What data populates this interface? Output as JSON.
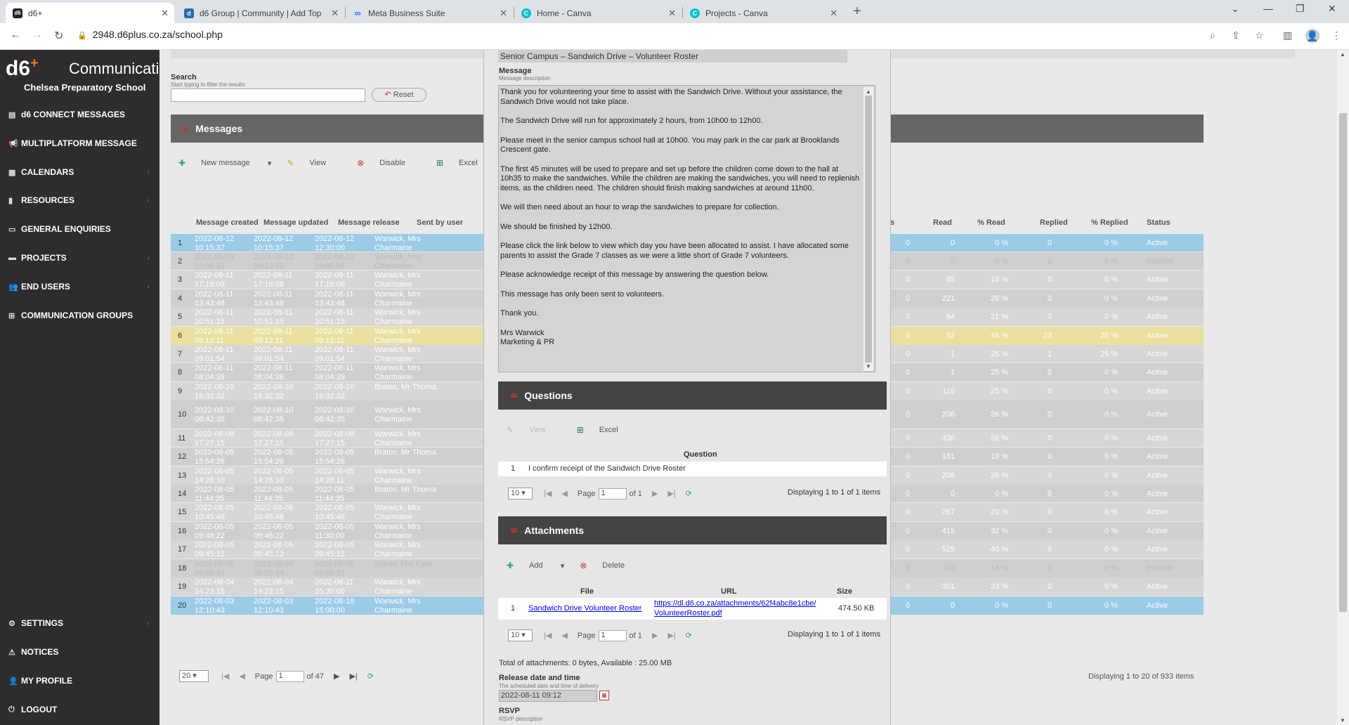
{
  "browser": {
    "tabs": [
      {
        "label": "d6+",
        "icon": "d6-favicon",
        "active": true
      },
      {
        "label": "d6 Group | Community | Add Top",
        "icon": "d6-group-favicon"
      },
      {
        "label": "Meta Business Suite",
        "icon": "meta-favicon"
      },
      {
        "label": "Home - Canva",
        "icon": "canva-favicon"
      },
      {
        "label": "Projects - Canva",
        "icon": "canva-favicon"
      }
    ],
    "url": "2948.d6plus.co.za/school.php"
  },
  "sidebar": {
    "logo": "d6",
    "logo_plus": "+",
    "logo_word": "Communication",
    "school": "Chelsea Preparatory School",
    "items": [
      {
        "label": "d6 CONNECT MESSAGES",
        "icon": "inbox-icon"
      },
      {
        "label": "MULTIPLATFORM MESSAGE",
        "icon": "megaphone-icon"
      },
      {
        "label": "CALENDARS",
        "icon": "calendar-icon"
      },
      {
        "label": "RESOURCES",
        "icon": "book-icon"
      },
      {
        "label": "GENERAL ENQUIRIES",
        "icon": "tray-icon"
      },
      {
        "label": "PROJECTS",
        "icon": "folder-icon"
      },
      {
        "label": "END USERS",
        "icon": "users-icon"
      },
      {
        "label": "COMMUNICATION GROUPS",
        "icon": "sitemap-icon"
      }
    ],
    "bottom_items": [
      {
        "label": "SETTINGS",
        "icon": "gear-icon"
      },
      {
        "label": "NOTICES",
        "icon": "warning-icon"
      },
      {
        "label": "MY PROFILE",
        "icon": "user-icon"
      },
      {
        "label": "LOGOUT",
        "icon": "power-icon"
      }
    ]
  },
  "search": {
    "label": "Search",
    "hint": "Start typing to filter the results",
    "reset_label": "Reset"
  },
  "messages_panel": {
    "title": "Messages",
    "toolbar": {
      "new_message": "New message",
      "view": "View",
      "disable": "Disable",
      "excel": "Excel"
    },
    "columns": [
      "Message created",
      "Message updated",
      "Message release",
      "Sent by user",
      "s",
      "Read",
      "% Read",
      "Replied",
      "% Replied",
      "Status"
    ],
    "rows": [
      {
        "n": "1",
        "created": [
          "2022-08-12",
          "10:15:37"
        ],
        "updated": [
          "2022-08-12",
          "10:15:37"
        ],
        "release": [
          "2022-08-12",
          "12:30:00"
        ],
        "user": [
          "Warwick, Mrs",
          "Charmaine"
        ],
        "s": "0",
        "read": "0",
        "pread": "0 %",
        "replied": "0",
        "preplied": "0 %",
        "status": "Active",
        "style": "sel"
      },
      {
        "n": "2",
        "created": [
          "2022-00-03",
          "12:04:33"
        ],
        "updated": [
          "2022-08-12",
          "10:12:42"
        ],
        "release": [
          "2022-08-12",
          "15:00:00"
        ],
        "user": [
          "Warwick, Mrs",
          "Charmaine"
        ],
        "s": "0",
        "read": "0",
        "pread": "0 %",
        "replied": "0",
        "preplied": "0 %",
        "status": "Inactive",
        "style": "inactive"
      },
      {
        "n": "3",
        "created": [
          "2022-08-11",
          "17:16:08"
        ],
        "updated": [
          "2022-08-11",
          "17:16:08"
        ],
        "release": [
          "2022-08-11",
          "17:16:08"
        ],
        "user": [
          "Warwick, Mrs",
          "Charmaine"
        ],
        "s": "0",
        "read": "85",
        "pread": "18 %",
        "replied": "0",
        "preplied": "0 %",
        "status": "Active",
        "style": ""
      },
      {
        "n": "4",
        "created": [
          "2022-08-11",
          "13:43:48"
        ],
        "updated": [
          "2022-08-11",
          "13:43:48"
        ],
        "release": [
          "2022-08-11",
          "13:43:48"
        ],
        "user": [
          "Warwick, Mrs",
          "Charmaine"
        ],
        "s": "0",
        "read": "221",
        "pread": "28 %",
        "replied": "0",
        "preplied": "0 %",
        "status": "Active",
        "style": ""
      },
      {
        "n": "5",
        "created": [
          "2022-08-11",
          "10:51:15"
        ],
        "updated": [
          "2022-08-11",
          "10:51:15"
        ],
        "release": [
          "2022-08-11",
          "10:51:15"
        ],
        "user": [
          "Warwick, Mrs",
          "Charmaine"
        ],
        "s": "0",
        "read": "64",
        "pread": "21 %",
        "replied": "0",
        "preplied": "0 %",
        "status": "Active",
        "style": ""
      },
      {
        "n": "6",
        "created": [
          "2022-08-11",
          "09:12:11"
        ],
        "updated": [
          "2022-08-11",
          "09:12:11"
        ],
        "release": [
          "2022-08-11",
          "09:12:11"
        ],
        "user": [
          "Warwick, Mrs",
          "Charmaine"
        ],
        "s": "0",
        "read": "52",
        "pread": "46 %",
        "replied": "23",
        "preplied": "20 %",
        "status": "Active",
        "style": "hl"
      },
      {
        "n": "7",
        "created": [
          "2022-08-11",
          "09:01:54"
        ],
        "updated": [
          "2022-08-11",
          "09:01:54"
        ],
        "release": [
          "2022-08-11",
          "09:01:54"
        ],
        "user": [
          "Warwick, Mrs",
          "Charmaine"
        ],
        "s": "0",
        "read": "1",
        "pread": "25 %",
        "replied": "1",
        "preplied": "25 %",
        "status": "Active",
        "style": ""
      },
      {
        "n": "8",
        "created": [
          "2022-08-11",
          "08:04:38"
        ],
        "updated": [
          "2022-08-11",
          "08:04:38"
        ],
        "release": [
          "2022-08-11",
          "08:04:39"
        ],
        "user": [
          "Warwick, Mrs",
          "Charmaine"
        ],
        "s": "0",
        "read": "1",
        "pread": "25 %",
        "replied": "0",
        "preplied": "0 %",
        "status": "Active",
        "style": ""
      },
      {
        "n": "9",
        "created": [
          "2022-08-10",
          "16:32:32"
        ],
        "updated": [
          "2022-08-10",
          "16:32:32"
        ],
        "release": [
          "2022-08-10",
          "16:32:32"
        ],
        "user": [
          "Bratos, Mr Thoma",
          ""
        ],
        "s": "0",
        "read": "116",
        "pread": "25 %",
        "replied": "0",
        "preplied": "0 %",
        "status": "Active",
        "style": ""
      },
      {
        "n": "10",
        "created": [
          "2022-08-10",
          "08:42:35"
        ],
        "updated": [
          "2022-08-10",
          "08:42:35"
        ],
        "release": [
          "2022-08-10",
          "08:42:35"
        ],
        "user": [
          "Warwick, Mrs",
          "Charmaine"
        ],
        "s": "0",
        "read": "206",
        "pread": "26 %",
        "replied": "0",
        "preplied": "0 %",
        "status": "Active",
        "style": ""
      },
      {
        "n": "11",
        "created": [
          "2022-08-09",
          "17:27:15"
        ],
        "updated": [
          "2022-08-09",
          "17:27:15"
        ],
        "release": [
          "2022-08-09",
          "17:27:15"
        ],
        "user": [
          "Warwick, Mrs",
          "Charmaine"
        ],
        "s": "0",
        "read": "336",
        "pread": "26 %",
        "replied": "0",
        "preplied": "0 %",
        "status": "Active",
        "style": ""
      },
      {
        "n": "12",
        "created": [
          "2022-08-05",
          "15:54:26"
        ],
        "updated": [
          "2022-08-05",
          "15:54:26"
        ],
        "release": [
          "2022-08-05",
          "15:54:26"
        ],
        "user": [
          "Bratos, Mr Thoma",
          ""
        ],
        "s": "0",
        "read": "181",
        "pread": "19 %",
        "replied": "0",
        "preplied": "0 %",
        "status": "Active",
        "style": ""
      },
      {
        "n": "13",
        "created": [
          "2022-08-05",
          "14:28:10"
        ],
        "updated": [
          "2022-08-05",
          "14:28:10"
        ],
        "release": [
          "2022-08-05",
          "14:28:11"
        ],
        "user": [
          "Warwick, Mrs",
          "Charmaine"
        ],
        "s": "0",
        "read": "206",
        "pread": "26 %",
        "replied": "0",
        "preplied": "0 %",
        "status": "Active",
        "style": ""
      },
      {
        "n": "14",
        "created": [
          "2022-08-05",
          "11:44:35"
        ],
        "updated": [
          "2022-08-05",
          "11:44:35"
        ],
        "release": [
          "2022-08-05",
          "11:44:35"
        ],
        "user": [
          "Bratos, Mr Thoma",
          ""
        ],
        "s": "0",
        "read": "0",
        "pread": "0 %",
        "replied": "0",
        "preplied": "0 %",
        "status": "Active",
        "style": ""
      },
      {
        "n": "15",
        "created": [
          "2022-08-05",
          "10:45:46"
        ],
        "updated": [
          "2022-08-05",
          "10:45:46"
        ],
        "release": [
          "2022-08-05",
          "10:45:46"
        ],
        "user": [
          "Warwick, Mrs",
          "Charmaine"
        ],
        "s": "0",
        "read": "267",
        "pread": "20 %",
        "replied": "0",
        "preplied": "0 %",
        "status": "Active",
        "style": ""
      },
      {
        "n": "16",
        "created": [
          "2022-08-05",
          "09:46:22"
        ],
        "updated": [
          "2022-08-05",
          "09:46:22"
        ],
        "release": [
          "2022-08-05",
          "11:30:00"
        ],
        "user": [
          "Warwick, Mrs",
          "Charmaine"
        ],
        "s": "0",
        "read": "415",
        "pread": "32 %",
        "replied": "0",
        "preplied": "0 %",
        "status": "Active",
        "style": ""
      },
      {
        "n": "17",
        "created": [
          "2022-08-05",
          "09:45:12"
        ],
        "updated": [
          "2022-08-05",
          "09:45:12"
        ],
        "release": [
          "2022-08-05",
          "09:45:12"
        ],
        "user": [
          "Warwick, Mrs",
          "Charmaine"
        ],
        "s": "0",
        "read": "525",
        "pread": "40 %",
        "replied": "0",
        "preplied": "0 %",
        "status": "Active",
        "style": ""
      },
      {
        "n": "18",
        "created": [
          "2022-08-05",
          "09:03:31"
        ],
        "updated": [
          "2022-08-05",
          "09:25:54"
        ],
        "release": [
          "2022-08-05",
          "09:03:32"
        ],
        "user": [
          "Spires, Mrs Kylie",
          ""
        ],
        "s": "0",
        "read": "103",
        "pread": "14 %",
        "replied": "0",
        "preplied": "0 %",
        "status": "Inactive",
        "style": "inactive"
      },
      {
        "n": "19",
        "created": [
          "2022-08-04",
          "14:23:15"
        ],
        "updated": [
          "2022-08-04",
          "14:23:15"
        ],
        "release": [
          "2022-08-11",
          "15:30:00"
        ],
        "user": [
          "Warwick, Mrs",
          "Charmaine"
        ],
        "s": "0",
        "read": "301",
        "pread": "23 %",
        "replied": "0",
        "preplied": "0 %",
        "status": "Active",
        "style": ""
      },
      {
        "n": "20",
        "created": [
          "2022-08-03",
          "12:10:43"
        ],
        "updated": [
          "2022-08-03",
          "12:10:43"
        ],
        "release": [
          "2022-08-18",
          "15:00:00"
        ],
        "user": [
          "Warwick, Mrs",
          "Charmaine"
        ],
        "s": "0",
        "read": "0",
        "pread": "0 %",
        "replied": "0",
        "preplied": "0 %",
        "status": "Active",
        "style": "sel"
      }
    ],
    "pager": {
      "page_size": "20",
      "page_label": "Page",
      "page": "1",
      "of": "of 47",
      "displaying": "Displaying 1 to 20 of 933 items"
    }
  },
  "dialog": {
    "subject": "Senior Campus – Sandwich Drive – Volunteer Roster",
    "message_label": "Message",
    "message_desc": "Message description",
    "message_paragraphs": [
      "Thank you for volunteering your time to assist with the Sandwich Drive.  Without your assistance, the Sandwich Drive would not take place.",
      "The Sandwich Drive will run for approximately 2 hours, from 10h00 to 12h00.",
      "Please meet in the senior campus school hall at 10h00.  You may park in the car park at Brooklands Crescent gate.",
      "The first 45 minutes will be used to prepare and set up before the children come down to the hall at 10h35 to make the sandwiches.  While the children are making the sandwiches, you will need to replenish items, as the children need.  The children should finish making sandwiches at around 11h00.",
      "We will then need about an hour to wrap the sandwiches to prepare for collection.",
      "We should be finished by 12h00.",
      "Please click the link below to view which day you have been allocated to assist.  I have allocated some parents to assist the Grade 7 classes as we were a little short of Grade 7 volunteers.",
      "Please acknowledge receipt of this message by answering the question below.",
      "This message has only been sent to volunteers.",
      "Thank you.",
      "Mrs Warwick\nMarketing & PR"
    ],
    "questions": {
      "title": "Questions",
      "view": "View",
      "excel": "Excel",
      "col_question": "Question",
      "rows": [
        {
          "n": "1",
          "text": "I confirm receipt of the Sandwich Drive Roster"
        }
      ],
      "page_size": "10",
      "page_label": "Page",
      "page": "1",
      "of": "of 1",
      "displaying": "Displaying 1 to 1 of 1 items"
    },
    "attachments": {
      "title": "Attachments",
      "add": "Add",
      "delete": "Delete",
      "col_file": "File",
      "col_url": "URL",
      "col_size": "Size",
      "rows": [
        {
          "n": "1",
          "file": "Sandwich Drive Volunteer Roster",
          "url1": "https://dl.d6.co.za/attachments/62f4abc8e1cbe/S",
          "url2": "VolunteerRoster.pdf",
          "size": "474.50 KB"
        }
      ],
      "page_size": "10",
      "page_label": "Page",
      "page": "1",
      "of": "of 1",
      "displaying": "Displaying 1 to 1 of 1 items",
      "total": "Total of attachments: 0 bytes, Available : 25.00 MB"
    },
    "release_label": "Release date and time",
    "release_desc": "The scheduled date and time of delivery",
    "release_value": "2022-08-11 09:12",
    "rsvp_label": "RSVP",
    "rsvp_desc": "RSVP description"
  }
}
